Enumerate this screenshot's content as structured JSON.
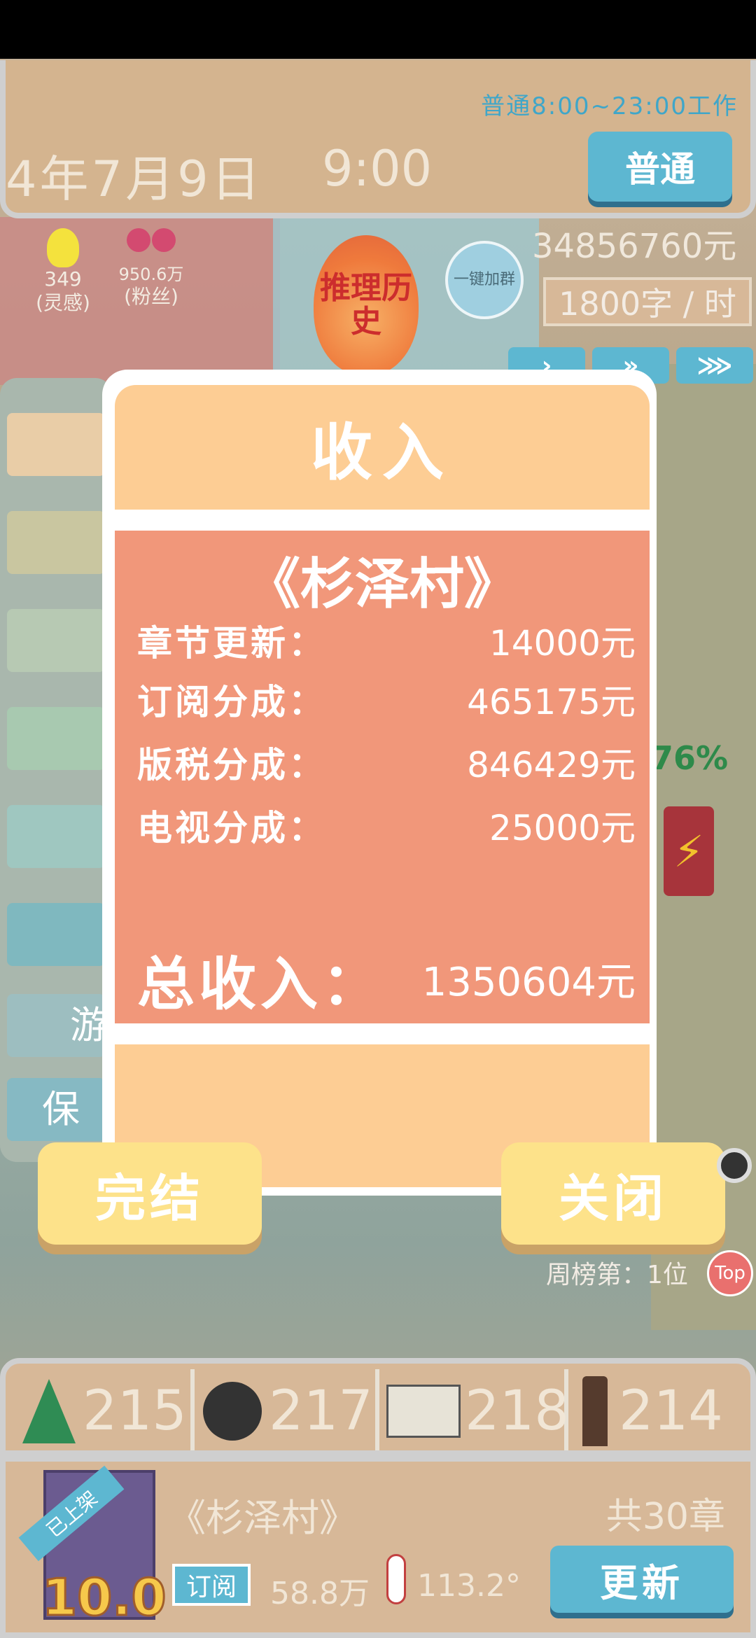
{
  "header": {
    "work_hours": "普通8:00~23:00工作",
    "date": "4年7月9日",
    "time": "9:00",
    "mode_button": "普通"
  },
  "status": {
    "inspiration_value": "349",
    "inspiration_label": "(灵感)",
    "fans_value": "950.6万",
    "fans_label": "(粉丝)",
    "history_badge": "推理历史",
    "join_group": "一键加群",
    "money": "34856760元",
    "writing_rate": "1800字 / 时",
    "speed_buttons": [
      "›",
      "»",
      "⋙"
    ],
    "energy_percent": "76%"
  },
  "dialog": {
    "title": "收入",
    "book_title": "《杉泽村》",
    "rows": [
      {
        "label": "章节更新：",
        "value": "14000元"
      },
      {
        "label": "订阅分成：",
        "value": "465175元"
      },
      {
        "label": "版税分成：",
        "value": "846429元"
      },
      {
        "label": "电视分成：",
        "value": "25000元"
      }
    ],
    "total_label": "总收入：",
    "total_value": "1350604元",
    "finish_button": "完结",
    "close_button": "关闭"
  },
  "side_menu": {
    "partial_labels": [
      "游",
      "保"
    ]
  },
  "ranking": {
    "weekly_rank": "周榜第：1位",
    "top_badge": "Top"
  },
  "stats": [
    {
      "icon": "tree-icon",
      "value": "215"
    },
    {
      "icon": "detective-icon",
      "value": "217"
    },
    {
      "icon": "book-icon",
      "value": "218"
    },
    {
      "icon": "pencil-icon",
      "value": "214"
    }
  ],
  "book_bar": {
    "listed_badge": "已上架",
    "score": "10.0",
    "title": "《杉泽村》",
    "chapters": "共30章",
    "subscribe_button": "订阅",
    "subscribers": "58.8万",
    "heat": "113.2°",
    "update_button": "更新"
  },
  "colors": {
    "accent_blue": "#5db7d1",
    "dialog_header": "#fdcd94",
    "dialog_body": "#f1977a",
    "button_yellow": "#fde28a"
  }
}
